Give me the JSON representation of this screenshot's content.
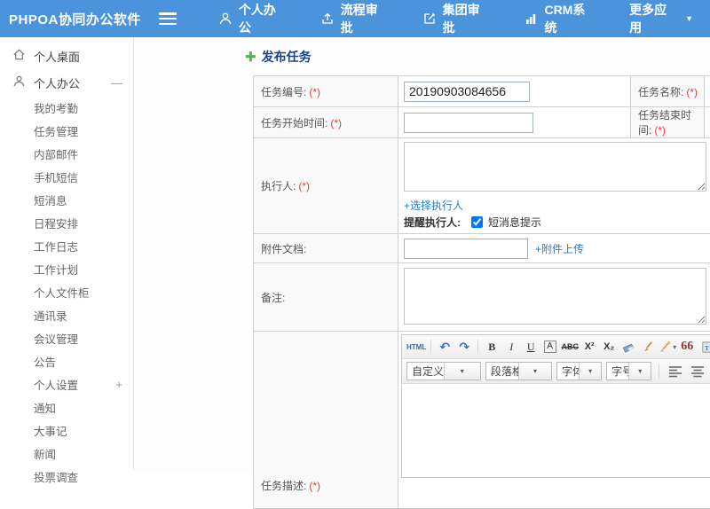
{
  "header": {
    "logo": "PHPOA协同办公软件",
    "nav": [
      {
        "label": "个人办公",
        "icon": "person-icon"
      },
      {
        "label": "流程审批",
        "icon": "flow-approve-icon"
      },
      {
        "label": "集团审批",
        "icon": "edit-approve-icon"
      },
      {
        "label": "CRM系统",
        "icon": "bar-chart-icon"
      },
      {
        "label": "更多应用",
        "icon": "caret-down-icon"
      }
    ],
    "caret": "▼"
  },
  "sidebar": {
    "items": [
      {
        "label": "个人桌面",
        "icon": "home-icon"
      },
      {
        "label": "个人办公",
        "icon": "person-icon",
        "toggle": "—"
      },
      {
        "label": "我的考勤"
      },
      {
        "label": "任务管理"
      },
      {
        "label": "内部邮件"
      },
      {
        "label": "手机短信"
      },
      {
        "label": "短消息"
      },
      {
        "label": "日程安排"
      },
      {
        "label": "工作日志"
      },
      {
        "label": "工作计划"
      },
      {
        "label": "个人文件柜"
      },
      {
        "label": "通讯录"
      },
      {
        "label": "会议管理"
      },
      {
        "label": "公告"
      },
      {
        "label": "个人设置",
        "toggle": "+"
      },
      {
        "label": "通知"
      },
      {
        "label": "大事记"
      },
      {
        "label": "新闻"
      },
      {
        "label": "投票调查"
      }
    ]
  },
  "main": {
    "title": "发布任务",
    "title_icon": "add-plus-icon",
    "form": {
      "required_mark": "(*)",
      "task_number_label": "任务编号:",
      "task_number_value": "20190903084656",
      "task_name_label": "任务名称:",
      "start_time_label": "任务开始时间:",
      "end_time_label": "任务结束时间:",
      "executor_label": "执行人:",
      "choose_executor_link": "+选择执行人",
      "remind_label": "提醒执行人:",
      "sms_checkbox_label": "短消息提示",
      "sms_checkbox_checked": true,
      "attachment_label": "附件文档:",
      "attachment_upload_link": "+附件上传",
      "remark_label": "备注:",
      "description_label": "任务描述:"
    },
    "editor": {
      "toolbar_glyphs": {
        "html": "HTML",
        "undo": "↶",
        "redo": "↷",
        "bold": "B",
        "italic": "I",
        "underline": "U",
        "font_border": "A",
        "strikethrough": "ABC",
        "superscript": "X²",
        "subscript": "X₂",
        "quote": "66",
        "font_color": "A"
      },
      "dropdowns": [
        {
          "label": "自定义标题"
        },
        {
          "label": "段落格式"
        },
        {
          "label": "字体"
        },
        {
          "label": "字号"
        }
      ]
    }
  },
  "colors": {
    "header_bg": "#4b94dc",
    "title_text": "#15428b",
    "link_blue": "#2e7cc3",
    "required_red": "#e43b3b",
    "plus_green": "#53b552",
    "label_cell_bg": "#f9f9f9",
    "border_gray": "#cfcfcf"
  }
}
